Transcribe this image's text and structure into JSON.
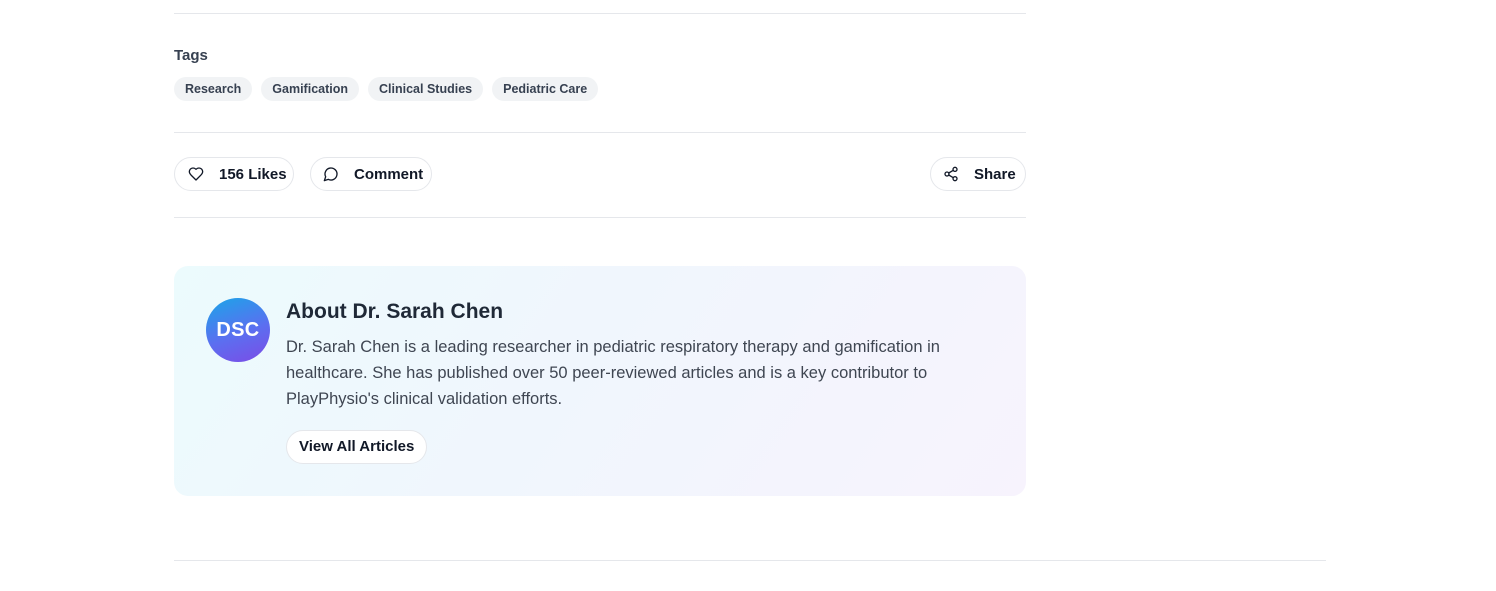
{
  "tags": {
    "title": "Tags",
    "items": [
      "Research",
      "Gamification",
      "Clinical Studies",
      "Pediatric Care"
    ]
  },
  "actions": {
    "likes_label": "156 Likes",
    "comment_label": "Comment",
    "share_label": "Share"
  },
  "author": {
    "initials": "DSC",
    "title": "About Dr. Sarah Chen",
    "bio": "Dr. Sarah Chen is a leading researcher in pediatric respiratory therapy and gamification in healthcare. She has published over 50 peer-reviewed articles and is a key contributor to PlayPhysio's clinical validation efforts.",
    "view_all_label": "View All Articles"
  },
  "icons": {
    "like": "heart-icon",
    "comment": "comment-bubble-icon",
    "share": "share-icon"
  }
}
